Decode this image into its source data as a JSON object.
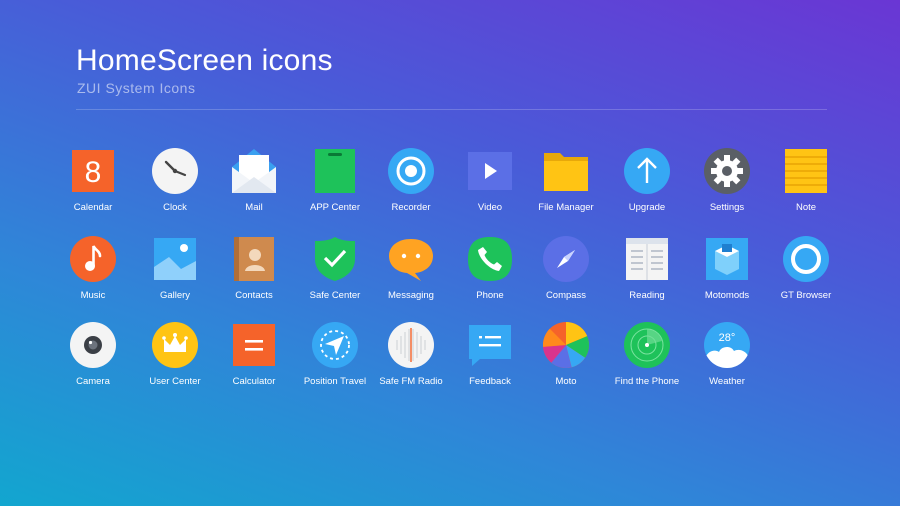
{
  "header": {
    "title": "HomeScreen icons",
    "subtitle": "ZUI System Icons"
  },
  "icons": [
    {
      "label": "Calendar",
      "icon": "calendar-icon",
      "color": "#f5632a",
      "glyph": "8"
    },
    {
      "label": "Clock",
      "icon": "clock-icon",
      "color": "#f4f4f4"
    },
    {
      "label": "Mail",
      "icon": "mail-icon",
      "color": "#3aa0f0"
    },
    {
      "label": "APP Center",
      "icon": "app-center-icon",
      "color": "#1ec25a"
    },
    {
      "label": "Recorder",
      "icon": "recorder-icon",
      "color": "#36a8f4"
    },
    {
      "label": "Video",
      "icon": "video-icon",
      "color": "#5b6fe6"
    },
    {
      "label": "File Manager",
      "icon": "folder-icon",
      "color": "#ffc414"
    },
    {
      "label": "Upgrade",
      "icon": "upgrade-icon",
      "color": "#36a8f4"
    },
    {
      "label": "Settings",
      "icon": "settings-icon",
      "color": "#5a5f66"
    },
    {
      "label": "Note",
      "icon": "note-icon",
      "color": "#ffc414"
    },
    {
      "label": "Music",
      "icon": "music-icon",
      "color": "#f5632a"
    },
    {
      "label": "Gallery",
      "icon": "gallery-icon",
      "color": "#36a8f4"
    },
    {
      "label": "Contacts",
      "icon": "contacts-icon",
      "color": "#cf8a4e"
    },
    {
      "label": "Safe Center",
      "icon": "shield-icon",
      "color": "#1ec25a"
    },
    {
      "label": "Messaging",
      "icon": "messaging-icon",
      "color": "#ffa322"
    },
    {
      "label": "Phone",
      "icon": "phone-icon",
      "color": "#1ec25a"
    },
    {
      "label": "Compass",
      "icon": "compass-icon",
      "color": "#5b6fe6"
    },
    {
      "label": "Reading",
      "icon": "reading-icon",
      "color": "#f4f4f4"
    },
    {
      "label": "Motomods",
      "icon": "motomods-icon",
      "color": "#36a8f4"
    },
    {
      "label": "GT Browser",
      "icon": "browser-icon",
      "color": "#36a8f4"
    },
    {
      "label": "Camera",
      "icon": "camera-icon",
      "color": "#f4f4f4"
    },
    {
      "label": "User Center",
      "icon": "crown-icon",
      "color": "#ffc414"
    },
    {
      "label": "Calculator",
      "icon": "calculator-icon",
      "color": "#f5632a"
    },
    {
      "label": "Position Travel",
      "icon": "position-travel-icon",
      "color": "#36a8f4"
    },
    {
      "label": "Safe FM Radio",
      "icon": "radio-icon",
      "color": "#f4f4f4"
    },
    {
      "label": "Feedback",
      "icon": "feedback-icon",
      "color": "#36a8f4"
    },
    {
      "label": "Moto",
      "icon": "moto-icon",
      "color": "#f5632a"
    },
    {
      "label": "Find the Phone",
      "icon": "radar-icon",
      "color": "#1ec25a"
    },
    {
      "label": "Weather",
      "icon": "weather-icon",
      "color": "#36a8f4",
      "glyph": "28°"
    }
  ]
}
